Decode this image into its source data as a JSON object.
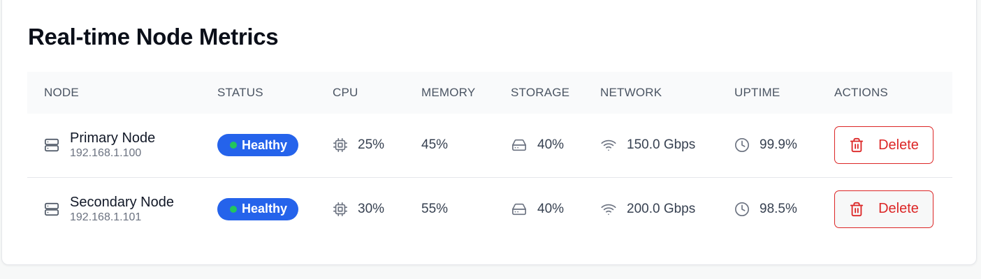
{
  "page": {
    "title": "Real-time Node Metrics"
  },
  "table": {
    "headers": {
      "node": "NODE",
      "status": "STATUS",
      "cpu": "CPU",
      "memory": "MEMORY",
      "storage": "STORAGE",
      "network": "NETWORK",
      "uptime": "UPTIME",
      "actions": "ACTIONS"
    },
    "rows": [
      {
        "name": "Primary Node",
        "ip": "192.168.1.100",
        "status": "Healthy",
        "cpu": "25%",
        "memory": "45%",
        "storage": "40%",
        "network": "150.0 Gbps",
        "uptime": "99.9%",
        "action": "Delete"
      },
      {
        "name": "Secondary Node",
        "ip": "192.168.1.101",
        "status": "Healthy",
        "cpu": "30%",
        "memory": "55%",
        "storage": "40%",
        "network": "200.0 Gbps",
        "uptime": "98.5%",
        "action": "Delete"
      }
    ]
  },
  "icons": {
    "node": "server-icon",
    "cpu": "cpu-icon",
    "storage": "hard-drive-icon",
    "network": "wifi-icon",
    "uptime": "clock-icon",
    "delete": "trash-icon"
  },
  "colors": {
    "status_badge": "#2563eb",
    "status_dot": "#22c55e",
    "danger": "#dc2626"
  }
}
